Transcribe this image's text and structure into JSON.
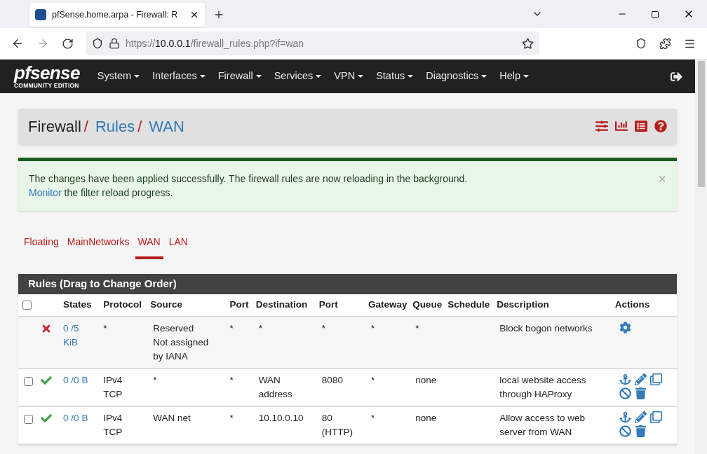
{
  "browser": {
    "tab_title": "pfSense.home.arpa - Firewall: R",
    "url_prefix": "https://",
    "url_host": "10.0.0.1",
    "url_path": "/firewall_rules.php?if=wan"
  },
  "logo": {
    "name": "pfsense",
    "edition": "COMMUNITY EDITION"
  },
  "nav": [
    "System",
    "Interfaces",
    "Firewall",
    "Services",
    "VPN",
    "Status",
    "Diagnostics",
    "Help"
  ],
  "breadcrumb": [
    {
      "label": "Firewall",
      "link": false
    },
    {
      "label": "Rules",
      "link": true
    },
    {
      "label": "WAN",
      "link": true
    }
  ],
  "separator": "/",
  "alert": {
    "message": "The changes have been applied successfully. The firewall rules are now reloading in the background.",
    "link": "Monitor",
    "rest": "the filter reload progress.",
    "close": "×"
  },
  "tabs": [
    {
      "label": "Floating",
      "selected": false
    },
    {
      "label": "MainNetworks",
      "selected": false
    },
    {
      "label": "WAN",
      "selected": true
    },
    {
      "label": "LAN",
      "selected": false
    }
  ],
  "panel_title": "Rules (Drag to Change Order)",
  "select_all": {
    "checked": false
  },
  "columns": [
    "States",
    "Protocol",
    "Source",
    "Port",
    "Destination",
    "Port",
    "Gateway",
    "Queue",
    "Schedule",
    "Description",
    "Actions"
  ],
  "rows": [
    {
      "kind": "block",
      "states": [
        "0 /5",
        "KiB"
      ],
      "protocol": [
        "*"
      ],
      "source": [
        "Reserved",
        "Not assigned",
        "by IANA"
      ],
      "source_port": "*",
      "destination": [
        "*"
      ],
      "port": [
        "*"
      ],
      "gateway": "*",
      "queue": "*",
      "description": [
        "Block bogon networks"
      ]
    },
    {
      "kind": "pass",
      "checked": false,
      "states": [
        "0 /0 B"
      ],
      "protocol": [
        "IPv4",
        "TCP"
      ],
      "source": [
        "*"
      ],
      "source_port": "*",
      "destination": [
        "WAN",
        "address"
      ],
      "port": [
        "8080"
      ],
      "gateway": "*",
      "queue": "none",
      "description": [
        "local website access",
        "through HAProxy"
      ]
    },
    {
      "kind": "pass",
      "checked": false,
      "states": [
        "0 /0 B"
      ],
      "protocol": [
        "IPv4",
        "TCP"
      ],
      "source": [
        "WAN net"
      ],
      "source_port": "*",
      "destination": [
        "10.10.0.10"
      ],
      "port": [
        "80",
        "(HTTP)"
      ],
      "gateway": "*",
      "queue": "none",
      "description": [
        "Allow access to web",
        "server from WAN"
      ]
    }
  ]
}
